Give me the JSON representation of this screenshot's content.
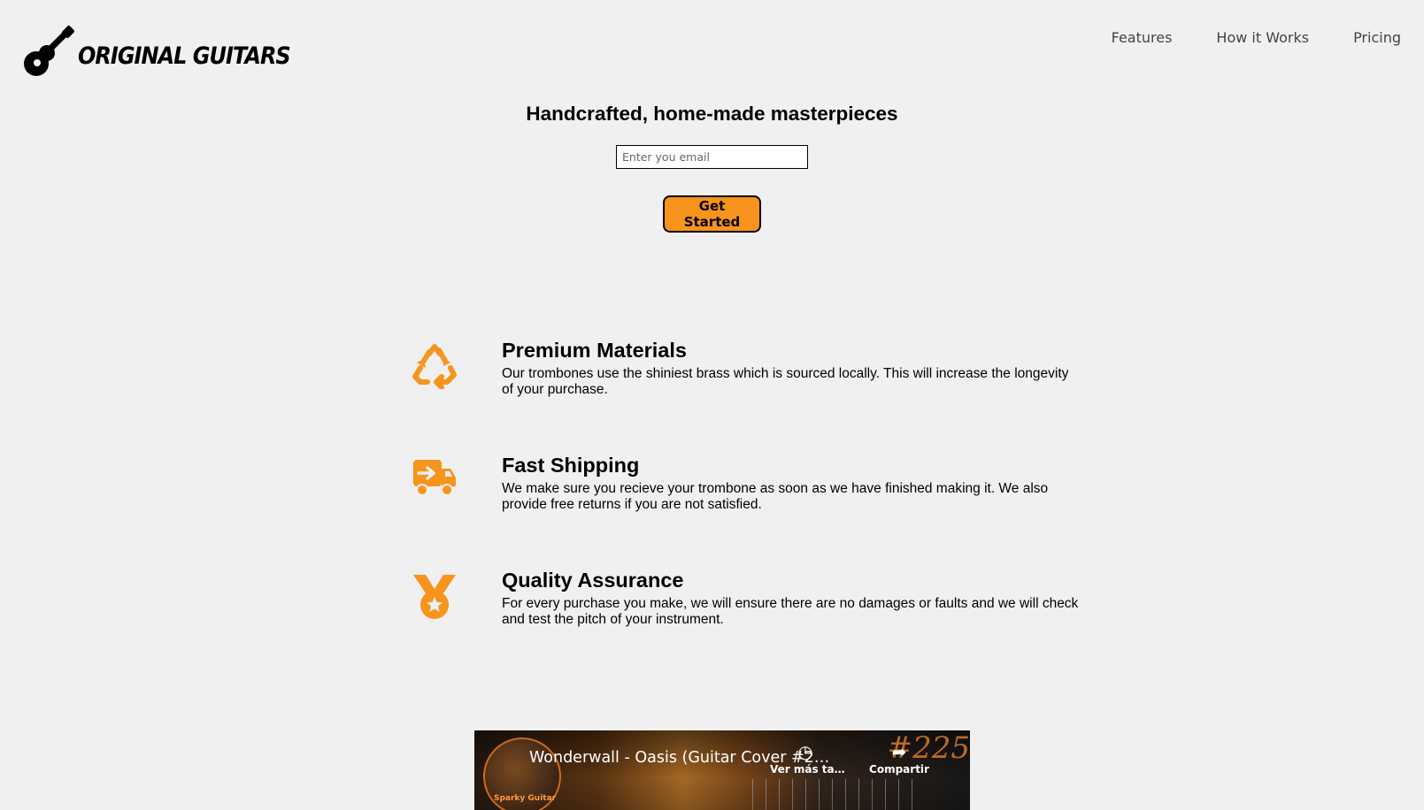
{
  "brand": {
    "name": "Original Guitars",
    "accent_color": "#f7941d"
  },
  "nav": {
    "items": [
      {
        "label": "Features"
      },
      {
        "label": "How it Works"
      },
      {
        "label": "Pricing"
      }
    ]
  },
  "hero": {
    "heading": "Handcrafted, home-made masterpieces",
    "email_placeholder": "Enter you email",
    "cta_label": "Get Started"
  },
  "features": [
    {
      "icon": "recycle-icon",
      "title": "Premium Materials",
      "description": "Our trombones use the shiniest brass which is sourced locally. This will increase the longevity of your purchase."
    },
    {
      "icon": "shipping-truck-icon",
      "title": "Fast Shipping",
      "description": "We make sure you recieve your trombone as soon as we have finished making it. We also provide free returns if you are not satisfied."
    },
    {
      "icon": "medal-icon",
      "title": "Quality Assurance",
      "description": "For every purchase you make, we will ensure there are no damages or faults and we will check and test the pitch of your instrument."
    }
  ],
  "video": {
    "title": "Wonderwall - Oasis (Guitar Cover #2…",
    "channel_name": "Sparky Guitar",
    "watch_later_label": "Ver más ta…",
    "share_label": "Compartir",
    "badge_text": "#225"
  }
}
